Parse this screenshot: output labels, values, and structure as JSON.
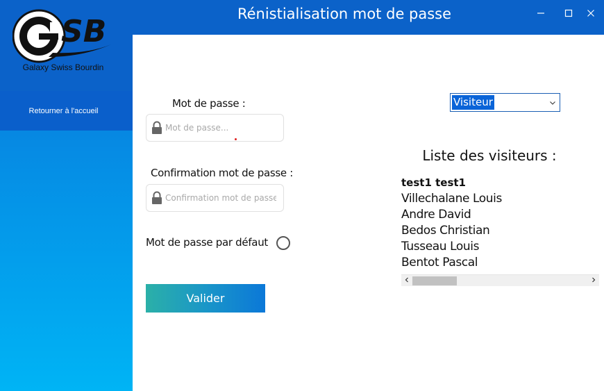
{
  "app": {
    "title": "Rénistialisation mot de passe",
    "logo_caption": "Galaxy Swiss Bourdin",
    "logo_letters": "GSB"
  },
  "sidebar": {
    "items": [
      {
        "label": "Retourner à l'accueil"
      }
    ]
  },
  "window_controls": [
    "minimize-icon",
    "maximize-icon",
    "close-icon"
  ],
  "form": {
    "password": {
      "label": "Mot de passe :",
      "placeholder": "Mot de passe...",
      "value": ""
    },
    "confirm": {
      "label": "Confirmation mot de passe :",
      "placeholder": "Confirmation mot de passe...",
      "value": ""
    },
    "default_password": {
      "label": "Mot de passe par défaut",
      "checked": false
    },
    "submit_label": "Valider"
  },
  "role_select": {
    "selected": "Visiteur"
  },
  "visitors": {
    "title": "Liste des visiteurs :",
    "items": [
      "test1 test1",
      "Villechalane Louis",
      "Andre David",
      "Bedos Christian",
      "Tusseau Louis",
      "Bentot Pascal"
    ]
  },
  "colors": {
    "header_blue": "#0b62c9",
    "sidebar_gradient_top": "#0a6fd6",
    "sidebar_gradient_bottom": "#00b4f5",
    "button_gradient_start": "#2bb0a8",
    "button_gradient_end": "#0b78d8",
    "selection_blue": "#0a64d8"
  }
}
